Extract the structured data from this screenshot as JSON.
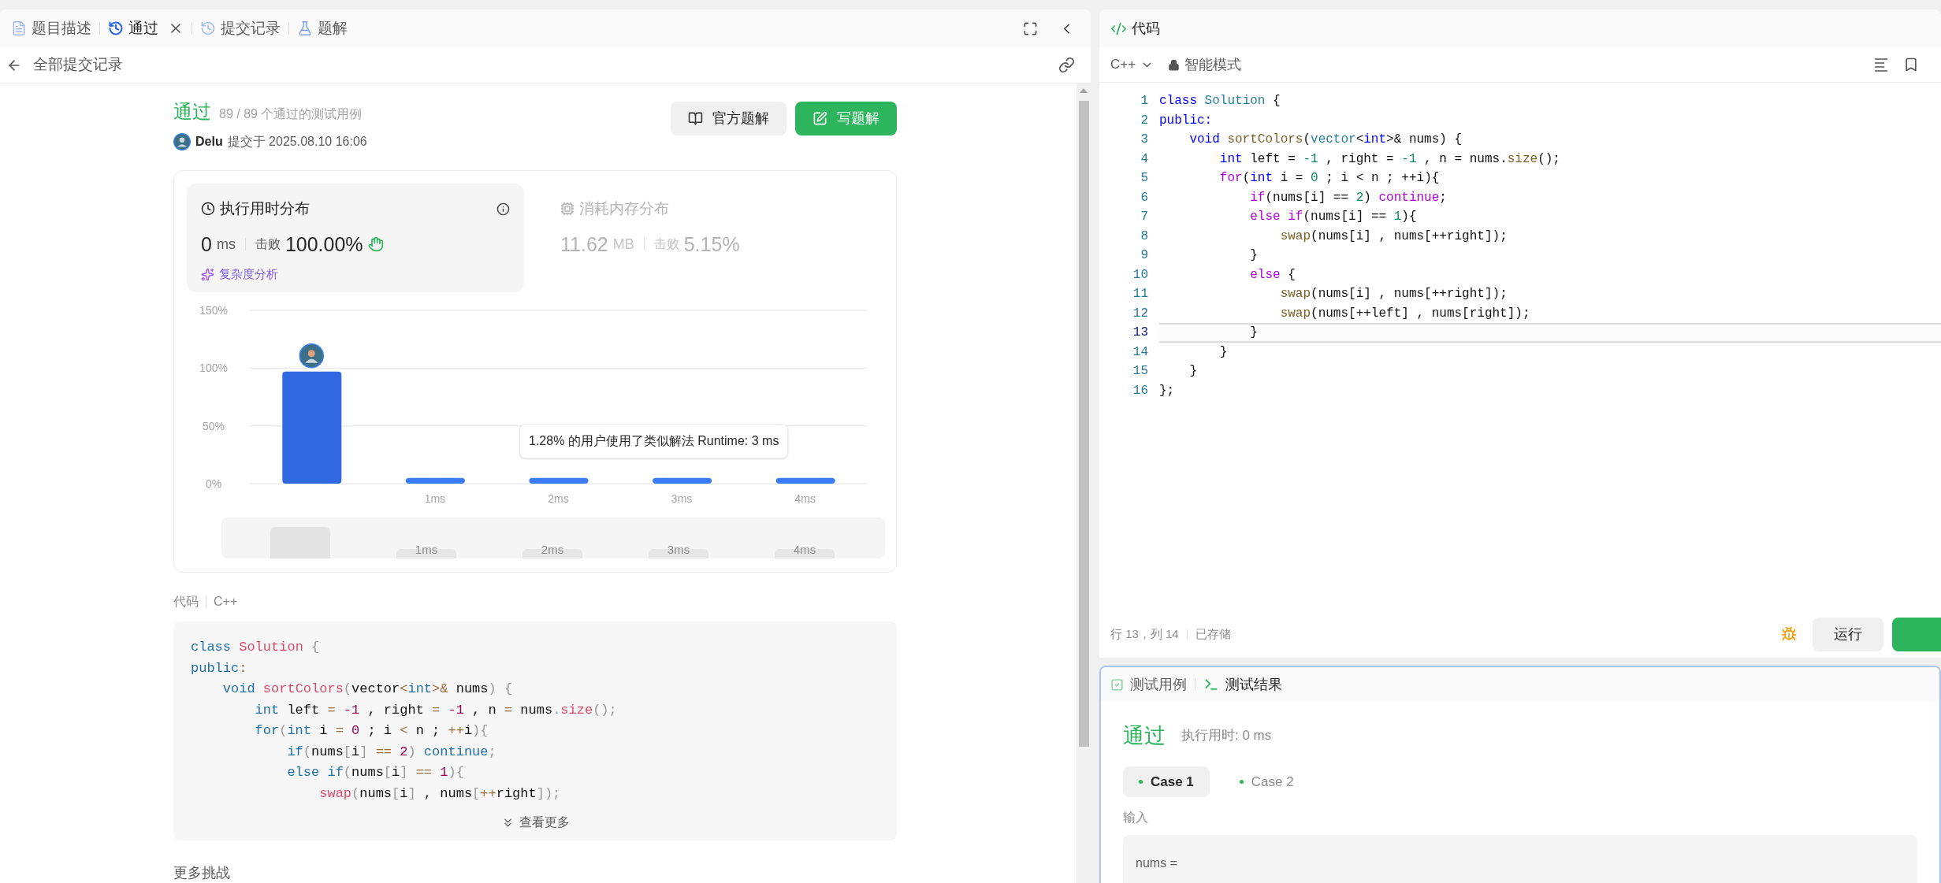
{
  "left_panel": {
    "tabs": [
      {
        "label": "题目描述",
        "kind": "description",
        "selected": false,
        "closable": false
      },
      {
        "label": "通过",
        "kind": "result",
        "selected": true,
        "closable": true
      },
      {
        "label": "提交记录",
        "kind": "submissions",
        "selected": false,
        "closable": false
      },
      {
        "label": "题解",
        "kind": "solutions",
        "selected": false,
        "closable": false
      }
    ],
    "back_link": "全部提交记录",
    "submission": {
      "status": "通过",
      "tests": "89 / 89 个通过的测试用例",
      "user": "Delu",
      "submitted": "提交于 2025.08.10 16:06"
    },
    "buttons": [
      {
        "label": "官方题解",
        "kind": "secondary"
      },
      {
        "label": "写题解",
        "kind": "primary"
      }
    ],
    "stats": [
      {
        "title": "执行用时分布",
        "kind": "runtime",
        "value": "0",
        "unit": "ms",
        "beats_label": "击败",
        "beats": "100.00%",
        "selected": true
      },
      {
        "title": "消耗内存分布",
        "kind": "memory",
        "value": "11.62",
        "unit": "MB",
        "beats_label": "击败",
        "beats": "5.15%",
        "selected": false
      }
    ],
    "complexity_link": "复杂度分析",
    "chart_data": {
      "type": "bar",
      "x": [
        0,
        1,
        2,
        3,
        4
      ],
      "values": [
        97,
        5,
        5,
        5,
        5
      ],
      "xlim": [
        -0.5,
        4.5
      ],
      "ylim": [
        0,
        150
      ],
      "yticks": [
        {
          "value": 0,
          "label": "0%"
        },
        {
          "value": 50,
          "label": "50%"
        },
        {
          "value": 100,
          "label": "100%"
        },
        {
          "value": 150,
          "label": "150%"
        }
      ],
      "xticks": [
        {
          "value": 1,
          "label": "1ms"
        },
        {
          "value": 2,
          "label": "2ms"
        },
        {
          "value": 3,
          "label": "3ms"
        },
        {
          "value": 4,
          "label": "4ms"
        }
      ]
    },
    "chart_tooltip": "1.28% 的用户使用了类似解法 Runtime: 3 ms",
    "navigator_labels": [
      "1ms",
      "2ms",
      "3ms",
      "4ms"
    ],
    "code_label": "代码",
    "code_language": "C++",
    "code_lines": [
      {
        "tokens": [
          {
            "text": "class",
            "kind": "kw"
          },
          {
            "text": " Solution",
            "kind": "cls"
          },
          {
            "text": " {",
            "kind": "punct"
          }
        ]
      },
      {
        "tokens": [
          {
            "text": "public",
            "kind": "kw"
          },
          {
            "text": ":",
            "kind": "op"
          }
        ]
      },
      {
        "tokens": [
          {
            "text": "    void",
            "kind": "kw"
          },
          {
            "text": " sortColors",
            "kind": "fn"
          },
          {
            "text": "(",
            "kind": "punct"
          },
          {
            "text": "vector",
            "kind": "type"
          },
          {
            "text": "<",
            "kind": "op"
          },
          {
            "text": "int",
            "kind": "kw"
          },
          {
            "text": ">&",
            "kind": "op"
          },
          {
            "text": " nums",
            "kind": "p"
          },
          {
            "text": ")",
            "kind": "punct"
          },
          {
            "text": " {",
            "kind": "punct"
          }
        ]
      },
      {
        "tokens": [
          {
            "text": "        int",
            "kind": "kw"
          },
          {
            "text": " left ",
            "kind": "p"
          },
          {
            "text": "=",
            "kind": "op"
          },
          {
            "text": " -1",
            "kind": "num"
          },
          {
            "text": " , right ",
            "kind": "p"
          },
          {
            "text": "=",
            "kind": "op"
          },
          {
            "text": " -1",
            "kind": "num"
          },
          {
            "text": " , n ",
            "kind": "p"
          },
          {
            "text": "=",
            "kind": "op"
          },
          {
            "text": " nums",
            "kind": "p"
          },
          {
            "text": ".",
            "kind": "punct"
          },
          {
            "text": "size",
            "kind": "fn"
          },
          {
            "text": "();",
            "kind": "punct"
          }
        ]
      },
      {
        "tokens": [
          {
            "text": "        for",
            "kind": "ctrl"
          },
          {
            "text": "(",
            "kind": "punct"
          },
          {
            "text": "int",
            "kind": "kw"
          },
          {
            "text": " i ",
            "kind": "p"
          },
          {
            "text": "=",
            "kind": "op"
          },
          {
            "text": " 0",
            "kind": "num"
          },
          {
            "text": " ; i ",
            "kind": "p"
          },
          {
            "text": "<",
            "kind": "op"
          },
          {
            "text": " n ; ",
            "kind": "p"
          },
          {
            "text": "++",
            "kind": "op"
          },
          {
            "text": "i",
            "kind": "p"
          },
          {
            "text": "){",
            "kind": "punct"
          }
        ]
      },
      {
        "tokens": [
          {
            "text": "            if",
            "kind": "ctrl"
          },
          {
            "text": "(",
            "kind": "punct"
          },
          {
            "text": "nums",
            "kind": "p"
          },
          {
            "text": "[",
            "kind": "punct"
          },
          {
            "text": "i",
            "kind": "p"
          },
          {
            "text": "]",
            "kind": "punct"
          },
          {
            "text": " ==",
            "kind": "op"
          },
          {
            "text": " 2",
            "kind": "num"
          },
          {
            "text": ")",
            "kind": "punct"
          },
          {
            "text": " continue",
            "kind": "ctrl"
          },
          {
            "text": ";",
            "kind": "punct"
          }
        ]
      },
      {
        "tokens": [
          {
            "text": "            else",
            "kind": "ctrl"
          },
          {
            "text": " if",
            "kind": "ctrl"
          },
          {
            "text": "(",
            "kind": "punct"
          },
          {
            "text": "nums",
            "kind": "p"
          },
          {
            "text": "[",
            "kind": "punct"
          },
          {
            "text": "i",
            "kind": "p"
          },
          {
            "text": "]",
            "kind": "punct"
          },
          {
            "text": " ==",
            "kind": "op"
          },
          {
            "text": " 1",
            "kind": "num"
          },
          {
            "text": "){",
            "kind": "punct"
          }
        ]
      },
      {
        "tokens": [
          {
            "text": "                swap",
            "kind": "fn"
          },
          {
            "text": "(",
            "kind": "punct"
          },
          {
            "text": "nums",
            "kind": "p"
          },
          {
            "text": "[",
            "kind": "punct"
          },
          {
            "text": "i",
            "kind": "p"
          },
          {
            "text": "]",
            "kind": "punct"
          },
          {
            "text": " , nums",
            "kind": "p"
          },
          {
            "text": "[",
            "kind": "punct"
          },
          {
            "text": "++",
            "kind": "op"
          },
          {
            "text": "right",
            "kind": "p"
          },
          {
            "text": "]);",
            "kind": "punct"
          }
        ]
      }
    ],
    "show_more": "查看更多",
    "more_challenges": "更多挑战"
  },
  "editor": {
    "title": "代码",
    "language": "C++",
    "mode": "智能模式",
    "lines": [
      {
        "number": "1",
        "active": false,
        "tokens": [
          {
            "text": "class",
            "kind": "kw"
          },
          {
            "text": " Solution",
            "kind": "cls"
          },
          {
            "text": " {",
            "kind": "punct"
          }
        ]
      },
      {
        "number": "2",
        "active": false,
        "tokens": [
          {
            "text": "public:",
            "kind": "kw"
          }
        ]
      },
      {
        "number": "3",
        "active": false,
        "tokens": [
          {
            "text": "    void",
            "kind": "kw"
          },
          {
            "text": " sortColors",
            "kind": "fn"
          },
          {
            "text": "(",
            "kind": "punct"
          },
          {
            "text": "vector",
            "kind": "type"
          },
          {
            "text": "<",
            "kind": "op"
          },
          {
            "text": "int",
            "kind": "kw"
          },
          {
            "text": ">&",
            "kind": "op"
          },
          {
            "text": " nums",
            "kind": "p"
          },
          {
            "text": ")",
            "kind": "punct"
          },
          {
            "text": " {",
            "kind": "punct"
          }
        ]
      },
      {
        "number": "4",
        "active": false,
        "tokens": [
          {
            "text": "        int",
            "kind": "kw"
          },
          {
            "text": " left ",
            "kind": "p"
          },
          {
            "text": "=",
            "kind": "op"
          },
          {
            "text": " -1",
            "kind": "num"
          },
          {
            "text": " , right ",
            "kind": "p"
          },
          {
            "text": "=",
            "kind": "op"
          },
          {
            "text": " -1",
            "kind": "num"
          },
          {
            "text": " , n ",
            "kind": "p"
          },
          {
            "text": "=",
            "kind": "op"
          },
          {
            "text": " nums",
            "kind": "p"
          },
          {
            "text": ".",
            "kind": "punct"
          },
          {
            "text": "size",
            "kind": "fn"
          },
          {
            "text": "();",
            "kind": "punct"
          }
        ]
      },
      {
        "number": "5",
        "active": false,
        "tokens": [
          {
            "text": "        for",
            "kind": "ctrl"
          },
          {
            "text": "(",
            "kind": "punct"
          },
          {
            "text": "int",
            "kind": "kw"
          },
          {
            "text": " i ",
            "kind": "p"
          },
          {
            "text": "=",
            "kind": "op"
          },
          {
            "text": " 0",
            "kind": "num"
          },
          {
            "text": " ; i ",
            "kind": "p"
          },
          {
            "text": "<",
            "kind": "op"
          },
          {
            "text": " n ; ",
            "kind": "p"
          },
          {
            "text": "++",
            "kind": "op"
          },
          {
            "text": "i",
            "kind": "p"
          },
          {
            "text": "){",
            "kind": "punct"
          }
        ]
      },
      {
        "number": "6",
        "active": false,
        "tokens": [
          {
            "text": "            if",
            "kind": "ctrl"
          },
          {
            "text": "(",
            "kind": "punct"
          },
          {
            "text": "nums",
            "kind": "p"
          },
          {
            "text": "[",
            "kind": "punct"
          },
          {
            "text": "i",
            "kind": "p"
          },
          {
            "text": "]",
            "kind": "punct"
          },
          {
            "text": " ==",
            "kind": "op"
          },
          {
            "text": " 2",
            "kind": "num"
          },
          {
            "text": ")",
            "kind": "punct"
          },
          {
            "text": " continue",
            "kind": "ctrl"
          },
          {
            "text": ";",
            "kind": "punct"
          }
        ]
      },
      {
        "number": "7",
        "active": false,
        "tokens": [
          {
            "text": "            else",
            "kind": "ctrl"
          },
          {
            "text": " if",
            "kind": "ctrl"
          },
          {
            "text": "(",
            "kind": "punct"
          },
          {
            "text": "nums",
            "kind": "p"
          },
          {
            "text": "[",
            "kind": "punct"
          },
          {
            "text": "i",
            "kind": "p"
          },
          {
            "text": "]",
            "kind": "punct"
          },
          {
            "text": " ==",
            "kind": "op"
          },
          {
            "text": " 1",
            "kind": "num"
          },
          {
            "text": "){",
            "kind": "punct"
          }
        ]
      },
      {
        "number": "8",
        "active": false,
        "tokens": [
          {
            "text": "                swap",
            "kind": "fn"
          },
          {
            "text": "(",
            "kind": "punct"
          },
          {
            "text": "nums",
            "kind": "p"
          },
          {
            "text": "[",
            "kind": "punct"
          },
          {
            "text": "i",
            "kind": "p"
          },
          {
            "text": "]",
            "kind": "punct"
          },
          {
            "text": " , nums",
            "kind": "p"
          },
          {
            "text": "[",
            "kind": "punct"
          },
          {
            "text": "++",
            "kind": "op"
          },
          {
            "text": "right",
            "kind": "p"
          },
          {
            "text": "]);",
            "kind": "punct"
          }
        ]
      },
      {
        "number": "9",
        "active": false,
        "tokens": [
          {
            "text": "            }",
            "kind": "punct"
          }
        ]
      },
      {
        "number": "10",
        "active": false,
        "tokens": [
          {
            "text": "            else",
            "kind": "ctrl"
          },
          {
            "text": " {",
            "kind": "punct"
          }
        ]
      },
      {
        "number": "11",
        "active": false,
        "tokens": [
          {
            "text": "                swap",
            "kind": "fn"
          },
          {
            "text": "(",
            "kind": "punct"
          },
          {
            "text": "nums",
            "kind": "p"
          },
          {
            "text": "[",
            "kind": "punct"
          },
          {
            "text": "i",
            "kind": "p"
          },
          {
            "text": "]",
            "kind": "punct"
          },
          {
            "text": " , nums",
            "kind": "p"
          },
          {
            "text": "[",
            "kind": "punct"
          },
          {
            "text": "++",
            "kind": "op"
          },
          {
            "text": "right",
            "kind": "p"
          },
          {
            "text": "]);",
            "kind": "punct"
          }
        ]
      },
      {
        "number": "12",
        "active": false,
        "tokens": [
          {
            "text": "                swap",
            "kind": "fn"
          },
          {
            "text": "(",
            "kind": "punct"
          },
          {
            "text": "nums",
            "kind": "p"
          },
          {
            "text": "[",
            "kind": "punct"
          },
          {
            "text": "++",
            "kind": "op"
          },
          {
            "text": "left",
            "kind": "p"
          },
          {
            "text": "]",
            "kind": "punct"
          },
          {
            "text": " , nums",
            "kind": "p"
          },
          {
            "text": "[",
            "kind": "punct"
          },
          {
            "text": "right",
            "kind": "p"
          },
          {
            "text": "]);",
            "kind": "punct"
          }
        ]
      },
      {
        "number": "13",
        "active": true,
        "tokens": [
          {
            "text": "            }",
            "kind": "punct"
          }
        ]
      },
      {
        "number": "14",
        "active": false,
        "tokens": [
          {
            "text": "        }",
            "kind": "punct"
          }
        ]
      },
      {
        "number": "15",
        "active": false,
        "tokens": [
          {
            "text": "    }",
            "kind": "punct"
          }
        ]
      },
      {
        "number": "16",
        "active": false,
        "tokens": [
          {
            "text": "};",
            "kind": "punct"
          }
        ]
      }
    ],
    "cursor": "行 13，列 14",
    "save_status": "已存储",
    "run_button": "运行"
  },
  "console": {
    "tabs": [
      {
        "label": "测试用例",
        "kind": "testcase",
        "selected": false
      },
      {
        "label": "测试结果",
        "kind": "result",
        "selected": true
      }
    ],
    "status": "通过",
    "runtime": "执行用时: 0 ms",
    "cases": [
      {
        "label": "Case 1",
        "selected": true
      },
      {
        "label": "Case 2",
        "selected": false
      }
    ],
    "input_label": "输入",
    "input_text": "nums ="
  }
}
